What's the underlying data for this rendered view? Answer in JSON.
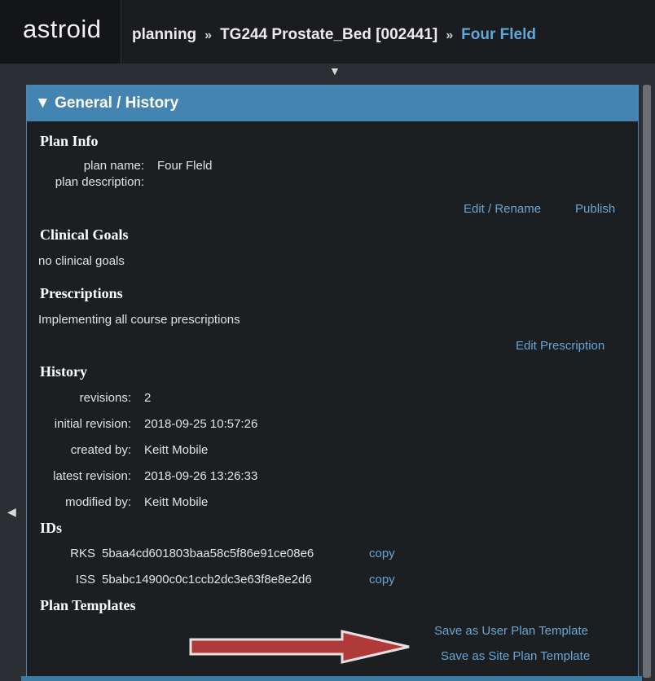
{
  "app": {
    "logo": "astroid"
  },
  "breadcrumb": {
    "items": [
      "planning",
      "TG244 Prostate_Bed [002441]",
      "Four Fleld"
    ],
    "separator": "»"
  },
  "panel": {
    "title": "▼ General / History",
    "plan_info": {
      "heading": "Plan Info",
      "name_label": "plan name:",
      "name_value": "Four Fleld",
      "desc_label": "plan description:",
      "desc_value": "",
      "edit_link": "Edit / Rename",
      "publish_link": "Publish"
    },
    "clinical_goals": {
      "heading": "Clinical Goals",
      "text": "no clinical goals"
    },
    "prescriptions": {
      "heading": "Prescriptions",
      "text": "Implementing all course prescriptions",
      "edit_link": "Edit Prescription"
    },
    "history": {
      "heading": "History",
      "rows": [
        {
          "label": "revisions:",
          "value": "2"
        },
        {
          "label": "initial revision:",
          "value": "2018-09-25 10:57:26"
        },
        {
          "label": "created by:",
          "value": "Keitt Mobile"
        },
        {
          "label": "latest revision:",
          "value": "2018-09-26 13:26:33"
        },
        {
          "label": "modified by:",
          "value": "Keitt Mobile"
        }
      ]
    },
    "ids": {
      "heading": "IDs",
      "rows": [
        {
          "label": "RKS",
          "value": "5baa4cd601803baa58c5f86e91ce08e6",
          "copy": "copy"
        },
        {
          "label": "ISS",
          "value": "5babc14900c0c1ccb2dc3e63f8e8e2d6",
          "copy": "copy"
        }
      ]
    },
    "templates": {
      "heading": "Plan Templates",
      "user_link": "Save as User Plan Template",
      "site_link": "Save as Site Plan Template"
    }
  },
  "colors": {
    "accent": "#4384b3",
    "link": "#6aa6d4",
    "arrow": "#b03a3a"
  },
  "icons": {
    "collapse": "triangle-down-icon",
    "side": "triangle-left-icon"
  }
}
